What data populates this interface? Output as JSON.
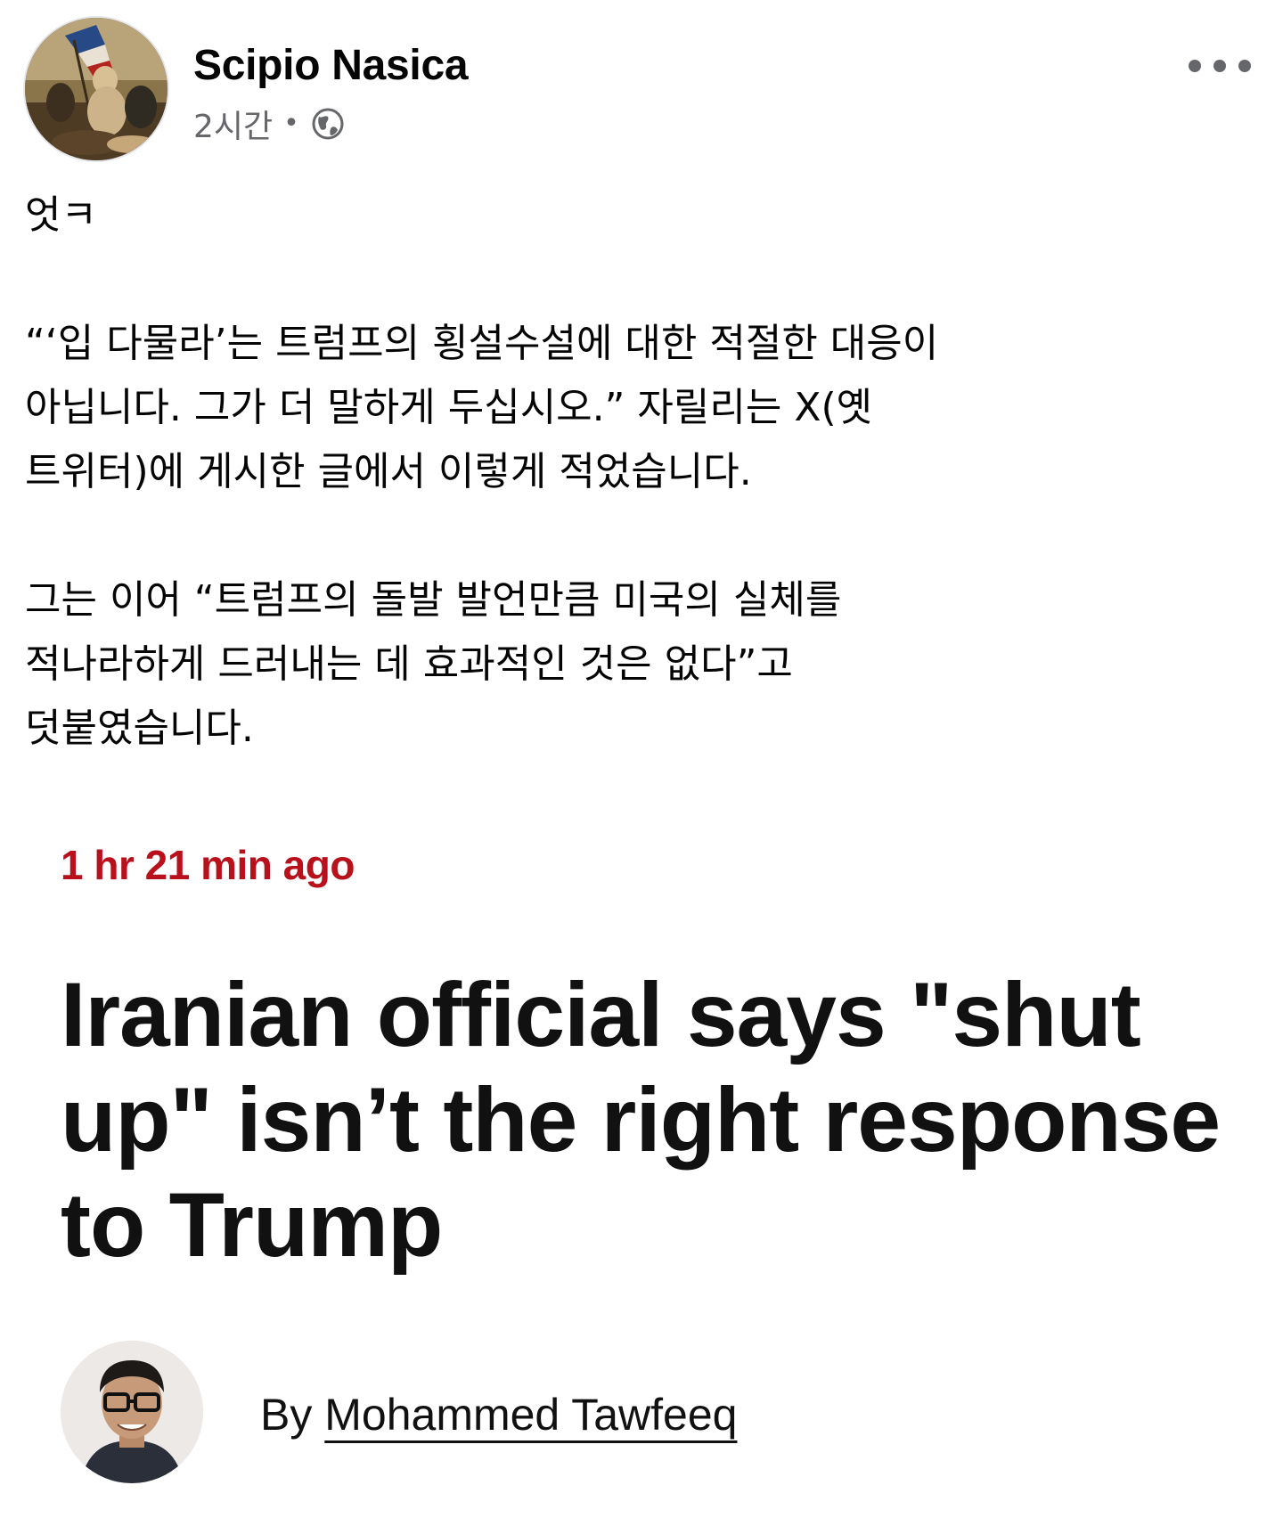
{
  "post": {
    "author": "Scipio Nasica",
    "time": "2시간",
    "separator": "•",
    "privacy_icon": "globe-icon",
    "avatar_icon": "profile-painting",
    "more_icon": "more-options-icon",
    "body": [
      "엇ㅋ",
      "“‘입 다물라’는 트럼프의 횡설수설에 대한 적절한 대응이\n아닙니다. 그가 더 말하게 두십시오.” 자릴리는 X(옛\n트위터)에 게시한 글에서 이렇게 적었습니다.",
      "그는 이어 “트럼프의 돌발 발언만큼 미국의 실체를\n적나라하게 드러내는 데 효과적인 것은 없다”고\n덧붙였습니다."
    ]
  },
  "article": {
    "time": "1 hr 21 min ago",
    "headline": "Iranian official says \"shut up\" isn’t the right response to Trump",
    "by_prefix": "By ",
    "by_name": "Mohammed Tawfeeq"
  },
  "colors": {
    "time_red": "#b8111b",
    "meta_gray": "#65676b",
    "text": "#050505"
  }
}
